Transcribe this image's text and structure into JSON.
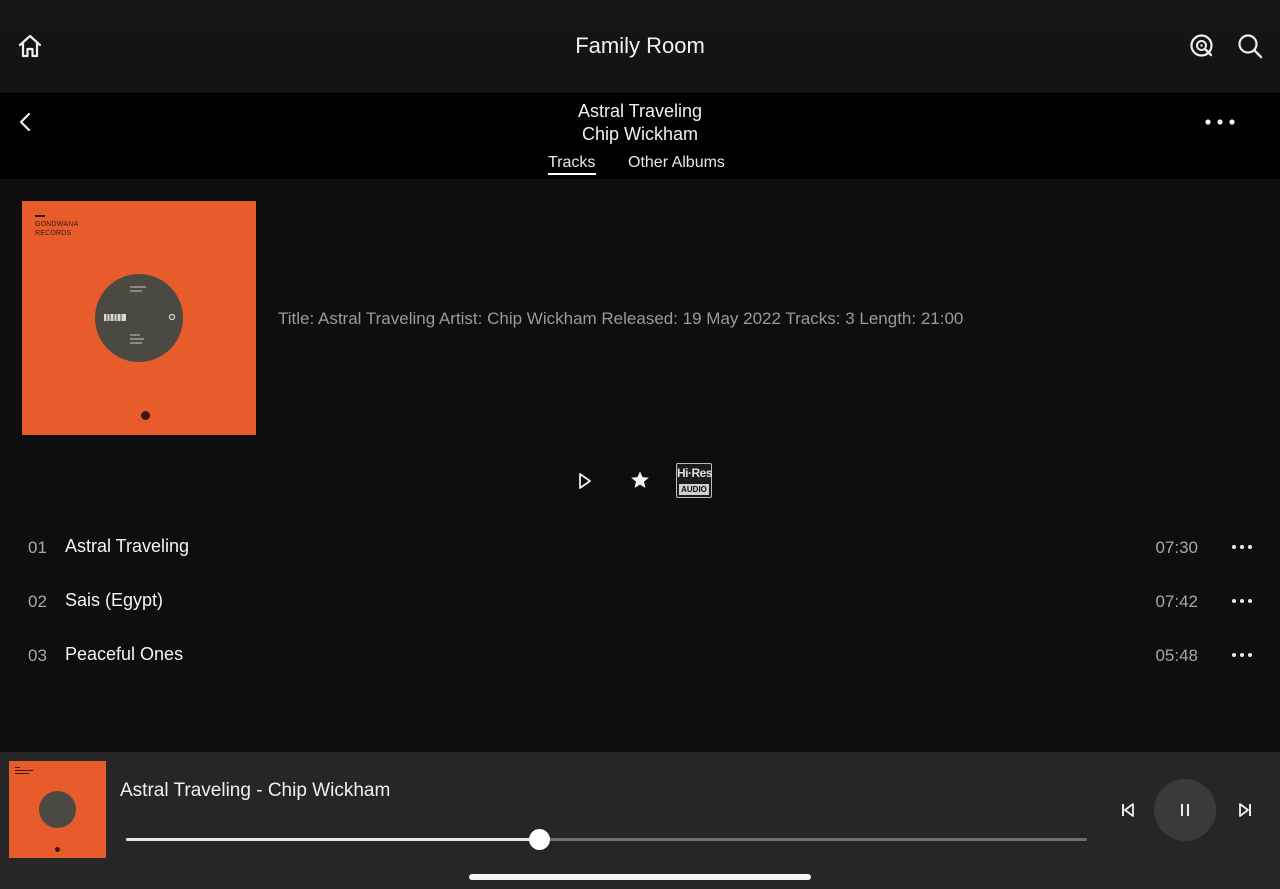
{
  "header": {
    "title": "Family Room",
    "icons": [
      "home-icon",
      "qobuz-icon",
      "search-icon"
    ]
  },
  "album_header": {
    "album": "Astral Traveling",
    "artist": "Chip Wickham",
    "tabs": [
      {
        "label": "Tracks",
        "active": true
      },
      {
        "label": "Other Albums",
        "active": false
      }
    ]
  },
  "cover": {
    "label_line1": "GONDWANA",
    "label_line2": "RECORDS",
    "background": "#e85c2c"
  },
  "album_info": {
    "text": "Title: Astral Traveling Artist: Chip Wickham Released: 19 May 2022 Tracks: 3 Length: 21:00"
  },
  "actions": {
    "hires_top": "Hi·Res",
    "hires_bottom": "AUDIO"
  },
  "tracks": [
    {
      "number": "01",
      "title": "Astral Traveling",
      "duration": "07:30"
    },
    {
      "number": "02",
      "title": "Sais (Egypt)",
      "duration": "07:42"
    },
    {
      "number": "03",
      "title": "Peaceful Ones",
      "duration": "05:48"
    }
  ],
  "now_playing": {
    "title": "Astral Traveling - Chip Wickham",
    "progress_fraction": 0.43,
    "state": "playing"
  },
  "colors": {
    "background": "#0e0e0e",
    "player_bar": "#262626",
    "cover_orange": "#e85c2c"
  }
}
